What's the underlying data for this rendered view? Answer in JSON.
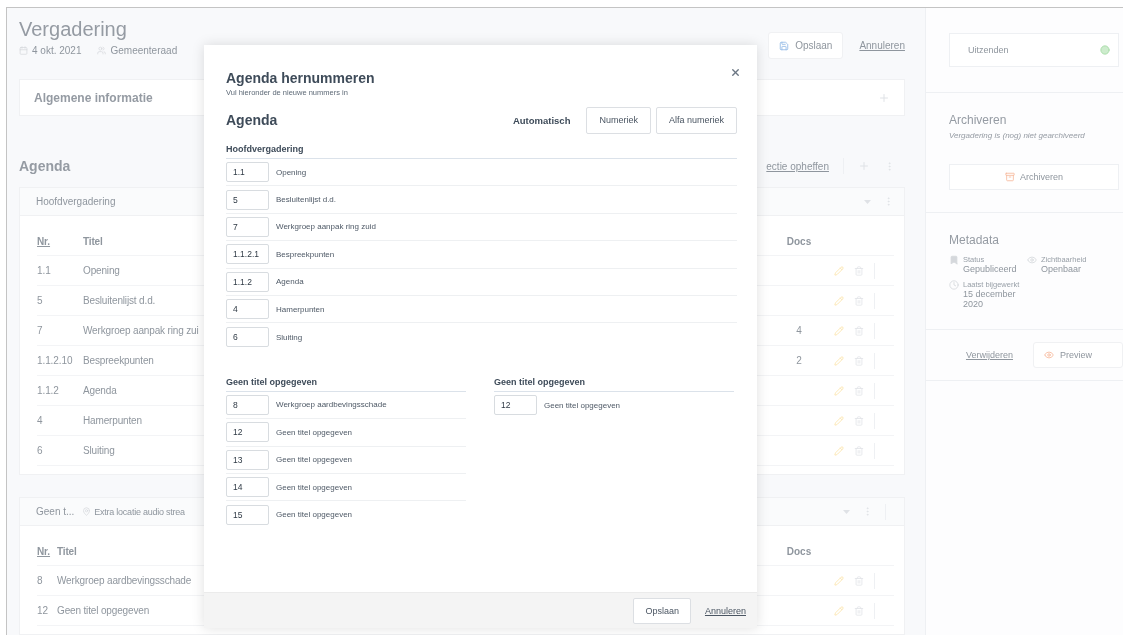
{
  "page": {
    "title": "Vergadering",
    "date": "4 okt. 2021",
    "group": "Gemeenteraad",
    "save_button": "Opslaan",
    "cancel_link": "Annuleren"
  },
  "general_info": {
    "title": "Algemene informatie"
  },
  "agenda": {
    "title": "Agenda",
    "clear_selection_link": "ectie opheffen",
    "sections": [
      {
        "header": "Hoofdvergadering",
        "columns": [
          "Nr.",
          "Titel",
          "Docs"
        ],
        "rows": [
          {
            "nr": "1.1",
            "title": "Opening"
          },
          {
            "nr": "5",
            "title": "Besluitenlijst d.d."
          },
          {
            "nr": "7",
            "title": "Werkgroep aanpak ring zui",
            "docs": "4"
          },
          {
            "nr": "1.1.2.10",
            "title": "Bespreekpunten",
            "docs": "2"
          },
          {
            "nr": "1.1.2",
            "title": "Agenda"
          },
          {
            "nr": "4",
            "title": "Hamerpunten"
          },
          {
            "nr": "6",
            "title": "Sluiting"
          }
        ]
      },
      {
        "header": "Geen t...",
        "location": "Extra locatie audio strea",
        "columns": [
          "Nr.",
          "Titel",
          "Docs"
        ],
        "rows": [
          {
            "nr": "8",
            "title": "Werkgroep aardbevingsschade"
          },
          {
            "nr": "12",
            "title": "Geen titel opgegeven"
          }
        ]
      }
    ]
  },
  "sidebar": {
    "broadcast": "Uitzenden",
    "archive": {
      "title": "Archiveren",
      "note": "Vergadering is (nog) niet gearchiveerd",
      "button": "Archiveren"
    },
    "metadata": {
      "title": "Metadata",
      "fields": [
        {
          "kind": "status",
          "label": "Status",
          "value": "Gepubliceerd"
        },
        {
          "kind": "visibility",
          "label": "Zichtbaarheid",
          "value": "Openbaar"
        },
        {
          "kind": "updated",
          "label": "Laatst bijgewerkt",
          "value": "15 december 2020"
        }
      ]
    },
    "delete_link": "Verwijderen",
    "preview_button": "Preview"
  },
  "modal": {
    "title": "Agenda hernummeren",
    "subtitle": "Vul hieronder de nieuwe nummers in",
    "heading": "Agenda",
    "auto_label": "Automatisch",
    "auto_buttons": [
      "Numeriek",
      "Alfa numeriek"
    ],
    "groups": [
      {
        "title": "Hoofdvergadering",
        "wide": true,
        "items": [
          {
            "number": "1.1",
            "title": "Opening"
          },
          {
            "number": "5",
            "title": "Besluitenlijst d.d."
          },
          {
            "number": "7",
            "title": "Werkgroep aanpak ring zuid"
          },
          {
            "number": "1.1.2.1",
            "title": "Bespreekpunten"
          },
          {
            "number": "1.1.2",
            "title": "Agenda"
          },
          {
            "number": "4",
            "title": "Hamerpunten"
          },
          {
            "number": "6",
            "title": "Sluiting"
          }
        ]
      },
      {
        "title": "Geen titel opgegeven",
        "wide": false,
        "items": [
          {
            "number": "8",
            "title": "Werkgroep aardbevingsschade"
          },
          {
            "number": "12",
            "title": "Geen titel opgegeven"
          },
          {
            "number": "13",
            "title": "Geen titel opgegeven"
          },
          {
            "number": "14",
            "title": "Geen titel opgegeven"
          },
          {
            "number": "15",
            "title": "Geen titel opgegeven"
          }
        ]
      },
      {
        "title": "Geen titel opgegeven",
        "wide": false,
        "items": [
          {
            "number": "12",
            "title": "Geen titel opgegeven"
          }
        ]
      }
    ],
    "save_button": "Opslaan",
    "cancel_link": "Annuleren"
  }
}
